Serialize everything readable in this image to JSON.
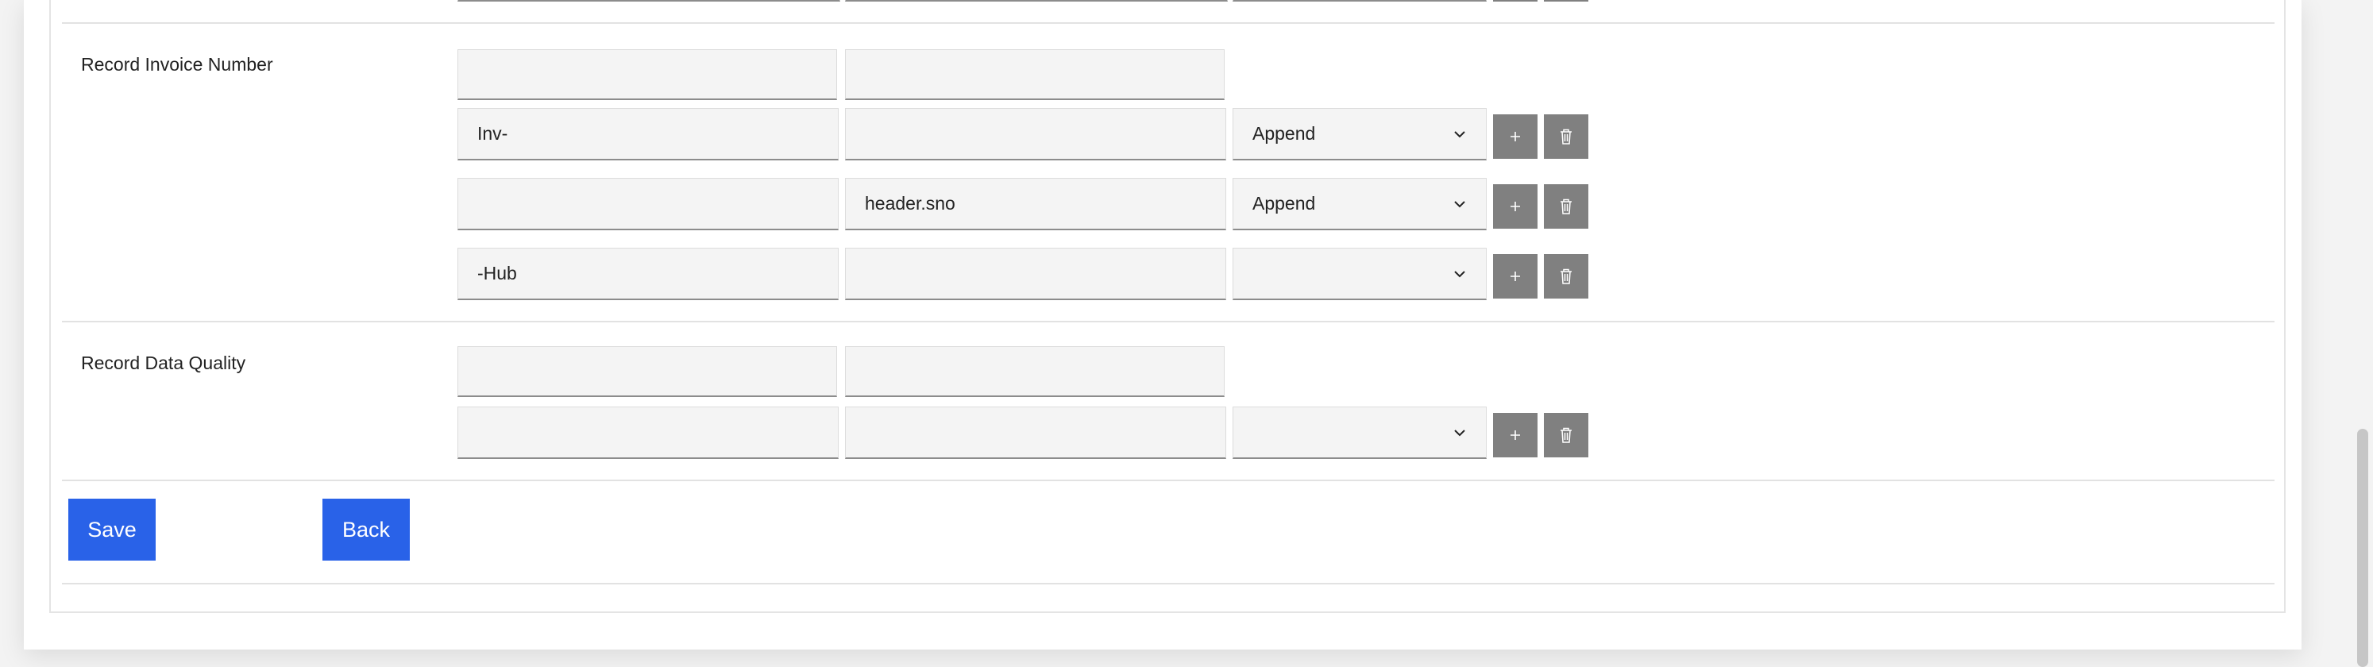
{
  "sections": [
    {
      "label": "Record Invoice Number",
      "header_fields": [
        "",
        ""
      ],
      "rows": [
        {
          "field1": "Inv-",
          "field2": "",
          "operation": "Append"
        },
        {
          "field1": "",
          "field2": "header.sno",
          "operation": "Append"
        },
        {
          "field1": "-Hub",
          "field2": "",
          "operation": ""
        }
      ]
    },
    {
      "label": "Record Data Quality",
      "header_fields": [
        "",
        ""
      ],
      "rows": [
        {
          "field1": "",
          "field2": "",
          "operation": ""
        }
      ]
    }
  ],
  "actions": {
    "save_label": "Save",
    "back_label": "Back"
  },
  "icons": {
    "add": "plus-icon",
    "delete": "trash-icon",
    "dropdown": "chevron-down-icon"
  },
  "colors": {
    "primary": "#2962e8",
    "icon_button": "#808080",
    "field_bg": "#f4f4f4"
  }
}
